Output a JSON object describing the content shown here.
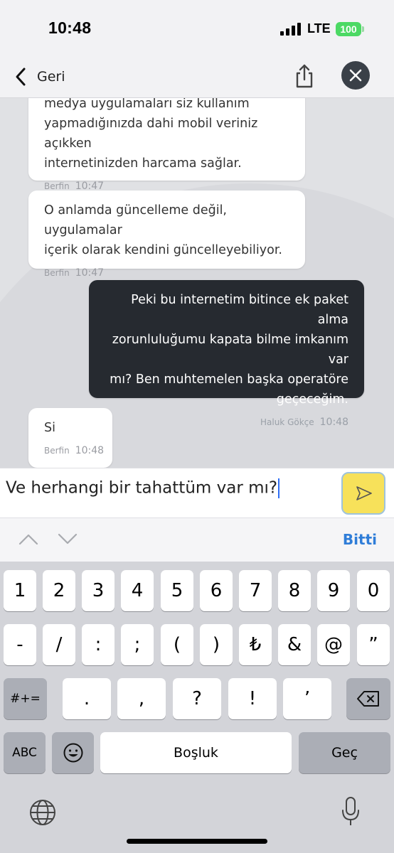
{
  "status_bar": {
    "time": "10:48",
    "network": "LTE",
    "battery": "100"
  },
  "nav": {
    "back_label": "Geri"
  },
  "messages": [
    {
      "direction": "in",
      "lines": [
        "medya uygulamaları siz kullanım",
        "yapmadığınızda dahi mobil veriniz açıkken",
        "internetinizden harcama sağlar."
      ],
      "sender": "Berfin",
      "time": "10:47"
    },
    {
      "direction": "in",
      "lines": [
        "O anlamda güncelleme değil, uygulamalar",
        "içerik olarak kendini güncelleyebiliyor."
      ],
      "sender": "Berfin",
      "time": "10:47"
    },
    {
      "direction": "out",
      "lines": [
        "Peki bu internetim bitince ek paket alma",
        "zorunluluğumu kapata bilme imkanım var",
        "mı? Ben muhtemelen başka operatöre",
        "geçeceğim."
      ],
      "sender": "Haluk Gökçe",
      "time": "10:48"
    },
    {
      "direction": "in",
      "lines": [
        "Si"
      ],
      "sender": "Berfin",
      "time": "10:48"
    }
  ],
  "composer": {
    "value": "Ve herhangi bir tahattüm var mı?"
  },
  "accessory": {
    "done_label": "Bitti"
  },
  "keyboard": {
    "row1": [
      "1",
      "2",
      "3",
      "4",
      "5",
      "6",
      "7",
      "8",
      "9",
      "0"
    ],
    "row2": [
      "-",
      "/",
      ":",
      ";",
      "(",
      ")",
      "₺",
      "&",
      "@",
      "”"
    ],
    "row3_toggle": "#+=",
    "row3": [
      ".",
      ",",
      "?",
      "!",
      "’"
    ],
    "abc_label": "ABC",
    "space_label": "Boşluk",
    "return_label": "Geç"
  },
  "colors": {
    "accent": "#2f7dd8",
    "send_button": "#f7e15a",
    "outgoing_bubble": "#262a30",
    "battery": "#4cd964"
  }
}
